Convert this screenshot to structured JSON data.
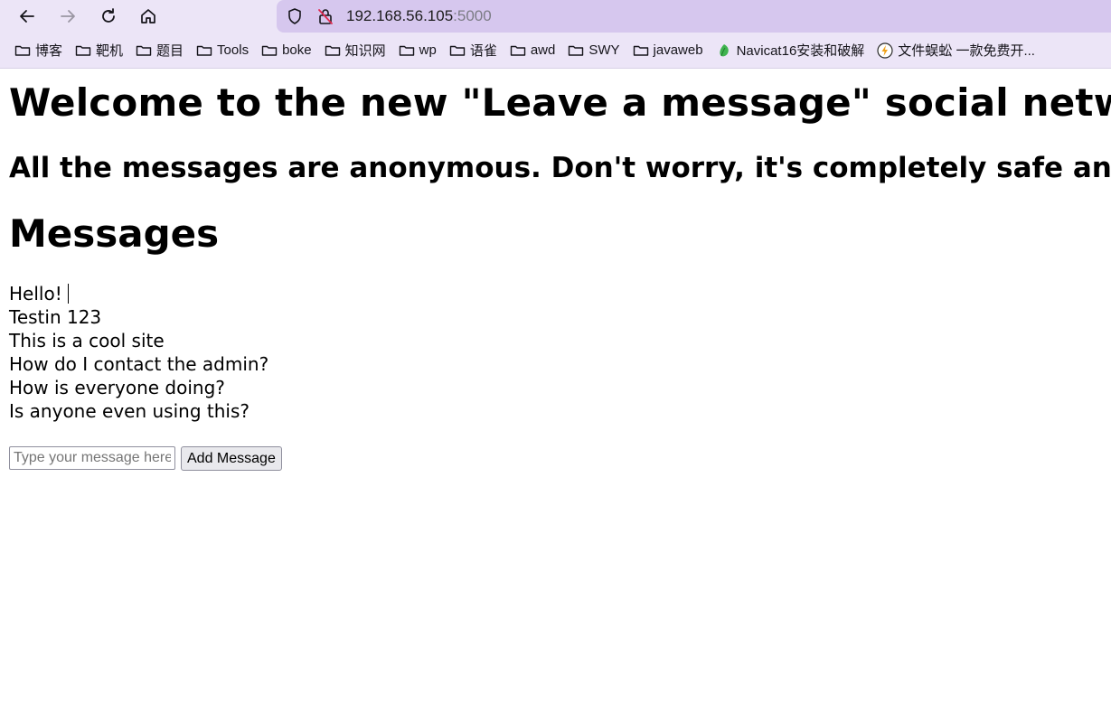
{
  "browser": {
    "url_host": "192.168.56.105",
    "url_port": ":5000",
    "icons": {
      "back": "arrow-left-icon",
      "forward": "arrow-right-icon",
      "reload": "reload-icon",
      "home": "home-icon",
      "shield": "shield-icon",
      "insecure": "insecure-lock-icon"
    },
    "bookmarks": [
      {
        "label": "博客",
        "icon": "folder-icon"
      },
      {
        "label": "靶机",
        "icon": "folder-icon"
      },
      {
        "label": "题目",
        "icon": "folder-icon"
      },
      {
        "label": "Tools",
        "icon": "folder-icon"
      },
      {
        "label": "boke",
        "icon": "folder-icon"
      },
      {
        "label": "知识网",
        "icon": "folder-icon"
      },
      {
        "label": "wp",
        "icon": "folder-icon"
      },
      {
        "label": "语雀",
        "icon": "folder-icon"
      },
      {
        "label": "awd",
        "icon": "folder-icon"
      },
      {
        "label": "SWY",
        "icon": "folder-icon"
      },
      {
        "label": "javaweb",
        "icon": "folder-icon"
      },
      {
        "label": "Navicat16安装和破解",
        "icon": "leaf-icon"
      },
      {
        "label": "文件蜈蚣 一款免费开...",
        "icon": "lightning-icon"
      }
    ]
  },
  "page": {
    "title": "Welcome to the new \"Leave a message\" social networking site",
    "subtitle": "All the messages are anonymous. Don't worry, it's completely safe and secure",
    "messages_heading": "Messages",
    "messages": [
      "Hello!",
      "Testin 123",
      "This is a cool site",
      "How do I contact the admin?",
      "How is everyone doing?",
      "Is anyone even using this?"
    ],
    "form": {
      "input_placeholder": "Type your message here",
      "input_value": "",
      "submit_label": "Add Message"
    }
  },
  "colors": {
    "toolbar_bg": "#ece5f7",
    "urlbar_bg": "#d6c7ee",
    "insecure_accent": "#e22850"
  }
}
